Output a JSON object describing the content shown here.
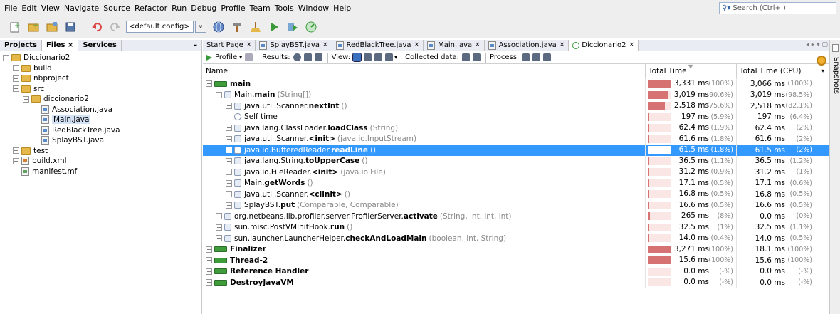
{
  "menu": [
    "File",
    "Edit",
    "View",
    "Navigate",
    "Source",
    "Refactor",
    "Run",
    "Debug",
    "Profile",
    "Team",
    "Tools",
    "Window",
    "Help"
  ],
  "search": {
    "placeholder": "Search (Ctrl+I)"
  },
  "toolbar": {
    "config": "<default config>",
    "config_arrow": "v"
  },
  "left": {
    "tabs": [
      "Projects",
      "Files",
      "Services"
    ],
    "close": "×",
    "minimize": "–",
    "tree": [
      {
        "label": "Diccionario2",
        "depth": 0,
        "toggle": "−",
        "icon": "folder"
      },
      {
        "label": "build",
        "depth": 1,
        "toggle": "+",
        "icon": "folder"
      },
      {
        "label": "nbproject",
        "depth": 1,
        "toggle": "+",
        "icon": "folder"
      },
      {
        "label": "src",
        "depth": 1,
        "toggle": "−",
        "icon": "folder"
      },
      {
        "label": "diccionario2",
        "depth": 2,
        "toggle": "−",
        "icon": "folder"
      },
      {
        "label": "Association.java",
        "depth": 3,
        "toggle": "",
        "icon": "java"
      },
      {
        "label": "Main.java",
        "depth": 3,
        "toggle": "",
        "icon": "java",
        "selected": true
      },
      {
        "label": "RedBlackTree.java",
        "depth": 3,
        "toggle": "",
        "icon": "java"
      },
      {
        "label": "SplayBST.java",
        "depth": 3,
        "toggle": "",
        "icon": "java"
      },
      {
        "label": "test",
        "depth": 1,
        "toggle": "+",
        "icon": "folder"
      },
      {
        "label": "build.xml",
        "depth": 1,
        "toggle": "+",
        "icon": "xml"
      },
      {
        "label": "manifest.mf",
        "depth": 1,
        "toggle": "",
        "icon": "mf"
      }
    ]
  },
  "doc_tabs": [
    {
      "label": "Start Page",
      "active": false
    },
    {
      "label": "SplayBST.java",
      "active": false
    },
    {
      "label": "RedBlackTree.java",
      "active": false
    },
    {
      "label": "Main.java",
      "active": false
    },
    {
      "label": "Association.java",
      "active": false
    },
    {
      "label": "Diccionario2",
      "active": true
    }
  ],
  "tab_nav": "◂ ▸ ▾ ▢",
  "profiler_toolbar": {
    "profile": "Profile",
    "results": "Results:",
    "view": "View:",
    "collected": "Collected data:",
    "process": "Process:"
  },
  "table": {
    "col_name": "Name",
    "col_total": "Total Time",
    "col_cpu": "Total Time (CPU)",
    "rows": [
      {
        "depth": 0,
        "toggle": "−",
        "icon": "thread",
        "pre": "",
        "bold": "main",
        "args": "",
        "time": "3,331 ms",
        "pct": "(100%)",
        "frac": 1.0,
        "cpu": "3,066 ms",
        "cpct": "(100%)"
      },
      {
        "depth": 1,
        "toggle": "−",
        "icon": "method",
        "pre": "Main.",
        "bold": "main",
        "args": "(String[])",
        "time": "3,019 ms",
        "pct": "(90.6%)",
        "frac": 0.906,
        "cpu": "3,019 ms",
        "cpct": "(98.5%)"
      },
      {
        "depth": 2,
        "toggle": "+",
        "icon": "method",
        "pre": "java.util.Scanner.",
        "bold": "nextInt",
        "args": "()",
        "time": "2,518 ms",
        "pct": "(75.6%)",
        "frac": 0.756,
        "cpu": "2,518 ms",
        "cpct": "(82.1%)"
      },
      {
        "depth": 2,
        "toggle": "",
        "icon": "self",
        "pre": "Self time",
        "bold": "",
        "args": "",
        "time": "197 ms",
        "pct": "(5.9%)",
        "frac": 0.059,
        "cpu": "197 ms",
        "cpct": "(6.4%)"
      },
      {
        "depth": 2,
        "toggle": "+",
        "icon": "method",
        "pre": "java.lang.ClassLoader.",
        "bold": "loadClass",
        "args": "(String)",
        "time": "62.4 ms",
        "pct": "(1.9%)",
        "frac": 0.019,
        "cpu": "62.4 ms",
        "cpct": "(2%)"
      },
      {
        "depth": 2,
        "toggle": "+",
        "icon": "method",
        "pre": "java.util.Scanner.",
        "bold": "<init>",
        "args": "(java.io.InputStream)",
        "time": "61.6 ms",
        "pct": "(1.8%)",
        "frac": 0.018,
        "cpu": "61.6 ms",
        "cpct": "(2%)"
      },
      {
        "depth": 2,
        "toggle": "+",
        "icon": "method",
        "pre": "java.io.BufferedReader.",
        "bold": "readLine",
        "args": "()",
        "time": "61.5 ms",
        "pct": "(1.8%)",
        "frac": 0.018,
        "cpu": "61.5 ms",
        "cpct": "(2%)",
        "selected": true
      },
      {
        "depth": 2,
        "toggle": "+",
        "icon": "method",
        "pre": "java.lang.String.",
        "bold": "toUpperCase",
        "args": "()",
        "time": "36.5 ms",
        "pct": "(1.1%)",
        "frac": 0.011,
        "cpu": "36.5 ms",
        "cpct": "(1.2%)"
      },
      {
        "depth": 2,
        "toggle": "+",
        "icon": "method",
        "pre": "java.io.FileReader.",
        "bold": "<init>",
        "args": "(java.io.File)",
        "time": "31.2 ms",
        "pct": "(0.9%)",
        "frac": 0.009,
        "cpu": "31.2 ms",
        "cpct": "(1%)"
      },
      {
        "depth": 2,
        "toggle": "+",
        "icon": "method",
        "pre": "Main.",
        "bold": "getWords",
        "args": "()",
        "time": "17.1 ms",
        "pct": "(0.5%)",
        "frac": 0.005,
        "cpu": "17.1 ms",
        "cpct": "(0.6%)"
      },
      {
        "depth": 2,
        "toggle": "+",
        "icon": "method",
        "pre": "java.util.Scanner.",
        "bold": "<clinit>",
        "args": "()",
        "time": "16.8 ms",
        "pct": "(0.5%)",
        "frac": 0.005,
        "cpu": "16.8 ms",
        "cpct": "(0.5%)"
      },
      {
        "depth": 2,
        "toggle": "+",
        "icon": "method",
        "pre": "SplayBST.",
        "bold": "put",
        "args": "(Comparable, Comparable)",
        "time": "16.6 ms",
        "pct": "(0.5%)",
        "frac": 0.005,
        "cpu": "16.6 ms",
        "cpct": "(0.5%)"
      },
      {
        "depth": 1,
        "toggle": "+",
        "icon": "method",
        "pre": "org.netbeans.lib.profiler.server.ProfilerServer.",
        "bold": "activate",
        "args": "(String, int, int, int)",
        "time": "265 ms",
        "pct": "(8%)",
        "frac": 0.08,
        "cpu": "0.0 ms",
        "cpct": "(0%)"
      },
      {
        "depth": 1,
        "toggle": "+",
        "icon": "method",
        "pre": "sun.misc.PostVMInitHook.",
        "bold": "run",
        "args": "()",
        "time": "32.5 ms",
        "pct": "(1%)",
        "frac": 0.01,
        "cpu": "32.5 ms",
        "cpct": "(1.1%)"
      },
      {
        "depth": 1,
        "toggle": "+",
        "icon": "method",
        "pre": "sun.launcher.LauncherHelper.",
        "bold": "checkAndLoadMain",
        "args": "(boolean, int, String)",
        "time": "14.0 ms",
        "pct": "(0.4%)",
        "frac": 0.004,
        "cpu": "14.0 ms",
        "cpct": "(0.5%)"
      },
      {
        "depth": 0,
        "toggle": "+",
        "icon": "thread",
        "pre": "",
        "bold": "Finalizer",
        "args": "",
        "time": "3,271 ms",
        "pct": "(100%)",
        "frac": 1.0,
        "cpu": "18.1 ms",
        "cpct": "(100%)"
      },
      {
        "depth": 0,
        "toggle": "+",
        "icon": "thread",
        "pre": "",
        "bold": "Thread-2",
        "args": "",
        "time": "15.6 ms",
        "pct": "(100%)",
        "frac": 1.0,
        "cpu": "15.6 ms",
        "cpct": "(100%)"
      },
      {
        "depth": 0,
        "toggle": "+",
        "icon": "thread",
        "pre": "",
        "bold": "Reference Handler",
        "args": "",
        "time": "0.0 ms",
        "pct": "(-%)",
        "frac": 0,
        "cpu": "0.0 ms",
        "cpct": "(-%)"
      },
      {
        "depth": 0,
        "toggle": "+",
        "icon": "thread",
        "pre": "",
        "bold": "DestroyJavaVM",
        "args": "",
        "time": "0.0 ms",
        "pct": "(-%)",
        "frac": 0,
        "cpu": "0.0 ms",
        "cpct": "(-%)"
      }
    ]
  },
  "right": {
    "snapshots": "Snapshots"
  },
  "colors": {
    "bar": "#d77272",
    "bar_bg": "#fbe6e6",
    "selection": "#3399ff",
    "thread": "#3f9c3a"
  }
}
